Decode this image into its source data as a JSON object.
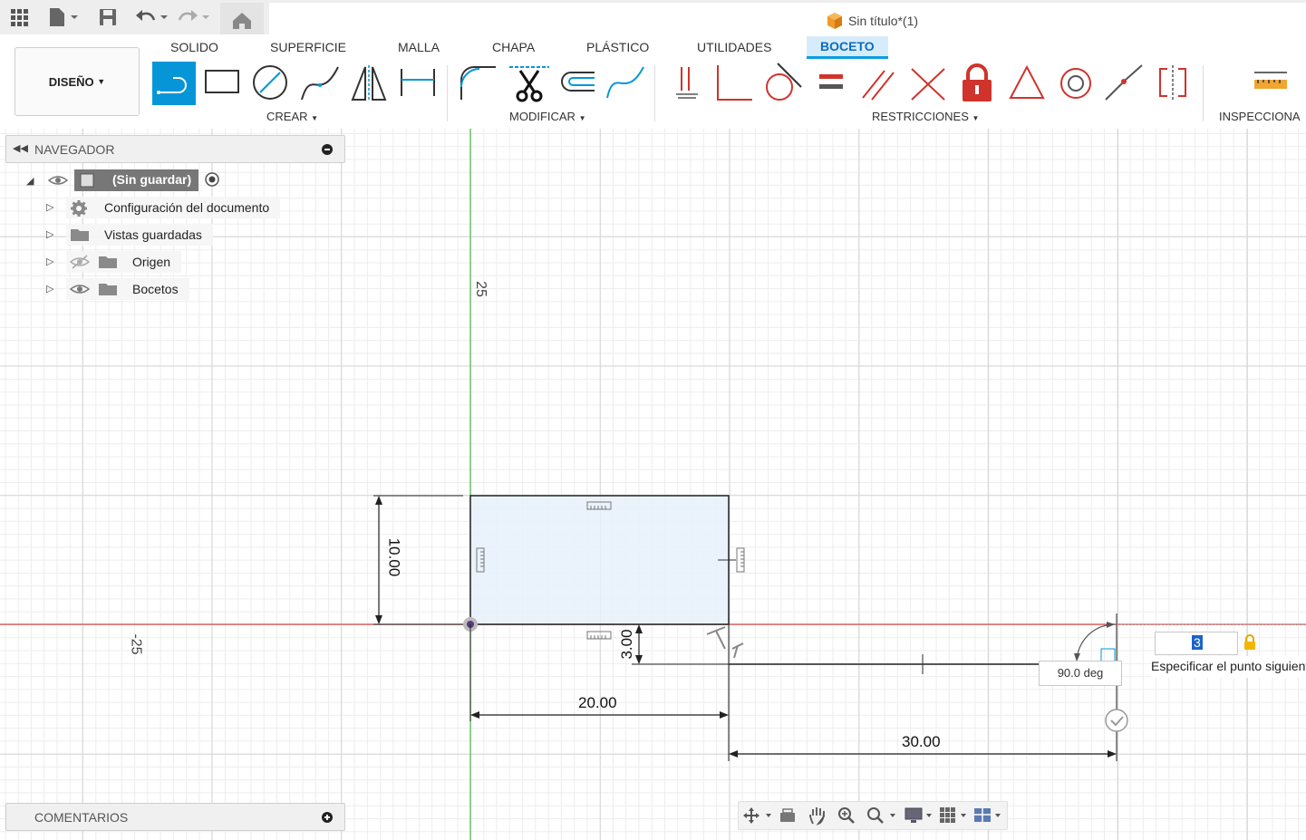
{
  "window": {
    "doc_title": "Sin título*(1)"
  },
  "ribbon": {
    "workspace": "DISEÑO",
    "tabs": [
      "SOLIDO",
      "SUPERFICIE",
      "MALLA",
      "CHAPA",
      "PLÁSTICO",
      "UTILIDADES",
      "BOCETO"
    ],
    "active_tab": "BOCETO",
    "groups": {
      "create": "CREAR",
      "modify": "MODIFICAR",
      "constraints": "RESTRICCIONES",
      "inspect": "INSPECCIONA"
    }
  },
  "navigator": {
    "title": "NAVEGADOR",
    "root": "(Sin guardar)",
    "items": [
      "Configuración del documento",
      "Vistas guardadas",
      "Origen",
      "Bocetos"
    ]
  },
  "comments": {
    "title": "COMENTARIOS"
  },
  "sketch": {
    "axis_labels": {
      "y_top": "25",
      "x_left": "-25"
    },
    "dimensions": {
      "height": "10.00",
      "width": "20.00",
      "offset": "3.00",
      "line_length": "30.00"
    },
    "angle": "90.0 deg",
    "length_input": "3",
    "tooltip": "Especificar el punto siguiente"
  },
  "colors": {
    "accent": "#0696d7",
    "constraint_red": "#d0332b",
    "sketch_fill": "#e6f1fb",
    "x_axis": "#e04a4a",
    "y_axis": "#4fbf4f"
  }
}
